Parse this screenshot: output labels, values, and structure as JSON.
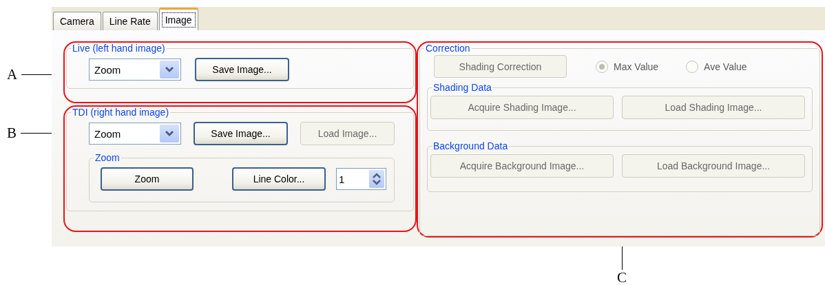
{
  "tabs": [
    {
      "label": "Camera",
      "selected": false
    },
    {
      "label": "Line Rate",
      "selected": false
    },
    {
      "label": "Image",
      "selected": true
    }
  ],
  "callouts": [
    {
      "label": "A"
    },
    {
      "label": "B"
    },
    {
      "label": "C"
    }
  ],
  "live": {
    "title": "Live (left hand image)",
    "dropdown": {
      "value": "Zoom"
    },
    "buttons": [
      {
        "label": "Save Image...",
        "disabled": false
      }
    ]
  },
  "tdi": {
    "title": "TDI (right hand image)",
    "dropdown": {
      "value": "Zoom"
    },
    "buttons": [
      {
        "label": "Save Image...",
        "disabled": false
      },
      {
        "label": "Load Image...",
        "disabled": true
      }
    ],
    "zoom_group": {
      "title": "Zoom",
      "buttons": [
        {
          "label": "Zoom",
          "disabled": false
        },
        {
          "label": "Line Color...",
          "disabled": false
        }
      ],
      "spinner": {
        "value": "1"
      }
    }
  },
  "correction": {
    "title": "Correction",
    "button": {
      "label": "Shading Correction",
      "disabled": true
    },
    "radios": [
      {
        "label": "Max Value",
        "selected": true,
        "disabled": true
      },
      {
        "label": "Ave Value",
        "selected": false,
        "disabled": true
      }
    ],
    "groups": [
      {
        "title": "Shading Data",
        "buttons": [
          {
            "label": "Acquire Shading Image...",
            "disabled": true
          },
          {
            "label": "Load Shading Image...",
            "disabled": true
          }
        ]
      },
      {
        "title": "Background Data",
        "buttons": [
          {
            "label": "Acquire Background Image...",
            "disabled": true
          },
          {
            "label": "Load Background Image...",
            "disabled": true
          }
        ]
      }
    ]
  }
}
